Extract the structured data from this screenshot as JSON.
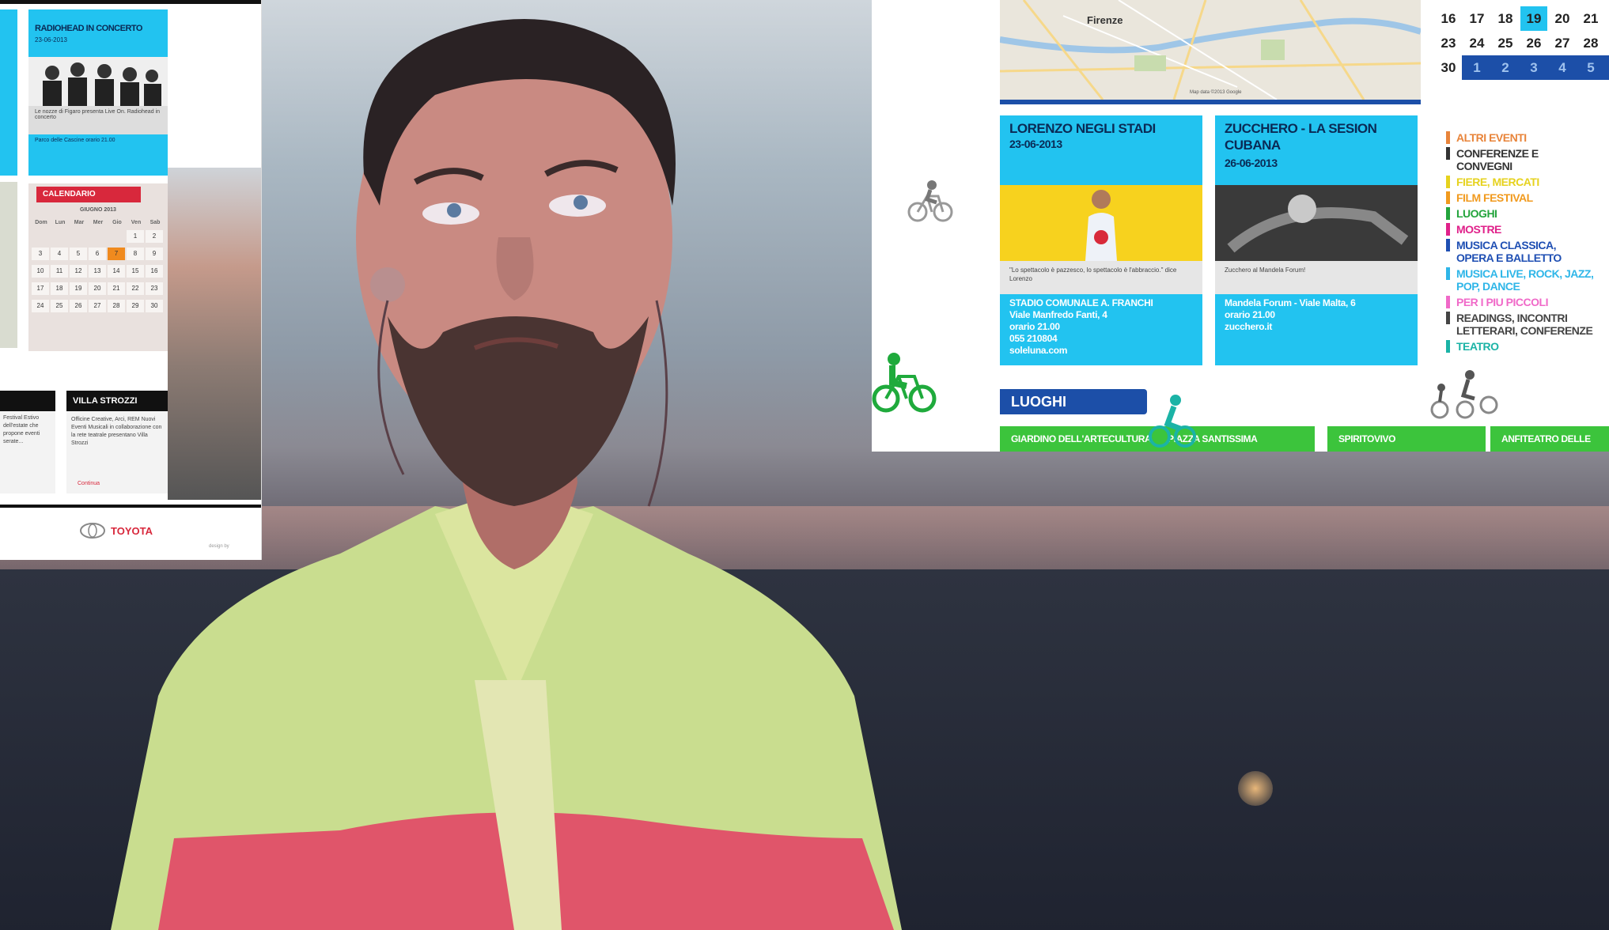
{
  "left_panel": {
    "top_event": {
      "header": "RADIOHEAD IN CONCERTO",
      "date": "23-06-2013",
      "caption": "Le nozze di Figaro presenta Live On. Radiohead in concerto",
      "venue": "Parco delle Cascine orario 21.00"
    },
    "calendar": {
      "label": "CALENDARIO",
      "month": "GIUGNO 2013",
      "weekdays": [
        "Dom",
        "Lun",
        "Mar",
        "Mer",
        "Gio",
        "Ven",
        "Sab"
      ],
      "weeks": [
        [
          "",
          "",
          "",
          "",
          "",
          "1",
          "2"
        ],
        [
          "3",
          "4",
          "5",
          "6",
          "7",
          "8",
          "9"
        ],
        [
          "10",
          "11",
          "12",
          "13",
          "14",
          "15",
          "16"
        ],
        [
          "17",
          "18",
          "19",
          "20",
          "21",
          "22",
          "23"
        ],
        [
          "24",
          "25",
          "26",
          "27",
          "28",
          "29",
          "30"
        ]
      ],
      "highlight_day": "7"
    },
    "villa": {
      "title": "VILLA STROZZI",
      "text": "Officine Creative, Arci, REM Nuovi Eventi Musicali in collaborazione con la rete teatrale presentano Villa Strozzi",
      "more": "Continua"
    },
    "side_text": "Festival Estivo dell'estate che propone eventi serate...",
    "sponsor": "TOYOTA",
    "credit": "design by"
  },
  "right_panel": {
    "map_city": "Firenze",
    "map_credit": "Map data ©2013 Google",
    "events": [
      {
        "title": "LORENZO NEGLI STADI",
        "date": "23-06-2013",
        "quote": "\"Lo spettacolo è pazzesco, lo spettacolo è l'abbraccio.\" dice Lorenzo",
        "venue_lines": [
          "STADIO COMUNALE A. FRANCHI",
          "Viale Manfredo Fanti, 4",
          "orario 21.00",
          "055 210804",
          "soleluna.com"
        ]
      },
      {
        "title": "ZUCCHERO - LA SESION CUBANA",
        "date": "26-06-2013",
        "quote": "Zucchero al Mandela Forum!",
        "venue_lines": [
          "Mandela Forum - Viale Malta, 6",
          "orario 21.00",
          "zucchero.it"
        ]
      }
    ],
    "calendar_rows": [
      [
        "16",
        "17",
        "18",
        "19",
        "20",
        "21"
      ],
      [
        "23",
        "24",
        "25",
        "26",
        "27",
        "28"
      ],
      [
        "30",
        "1",
        "2",
        "3",
        "4",
        "5"
      ]
    ],
    "categories": [
      {
        "label": "ALTRI EVENTI",
        "color": "#e8843a"
      },
      {
        "label": "CONFERENZE E CONVEGNI",
        "color": "#333333"
      },
      {
        "label": "FIERE, MERCATI",
        "color": "#e6d21e"
      },
      {
        "label": "FILM FESTIVAL",
        "color": "#f19a1e"
      },
      {
        "label": "LUOGHI",
        "color": "#23a43c"
      },
      {
        "label": "MOSTRE",
        "color": "#e0218a"
      },
      {
        "label": "MUSICA CLASSICA, OPERA E BALLETTO",
        "color": "#1f4fb3"
      },
      {
        "label": "MUSICA LIVE, ROCK, JAZZ, POP, DANCE",
        "color": "#2fb6e8"
      },
      {
        "label": "PER I PIU PICCOLI",
        "color": "#f069c8"
      },
      {
        "label": "READINGS, INCONTRI LETTERARI, CONFERENZE",
        "color": "#444444"
      },
      {
        "label": "TEATRO",
        "color": "#1bb3a6"
      }
    ],
    "luoghi": {
      "label": "LUOGHI",
      "places": [
        "GIARDINO DELL'ARTECULTURA",
        "PIAZZA SANTISSIMA ANNUNZIATA",
        "SPIRITOVIVO",
        "ANFITEATRO DELLE CASCINE"
      ]
    }
  }
}
